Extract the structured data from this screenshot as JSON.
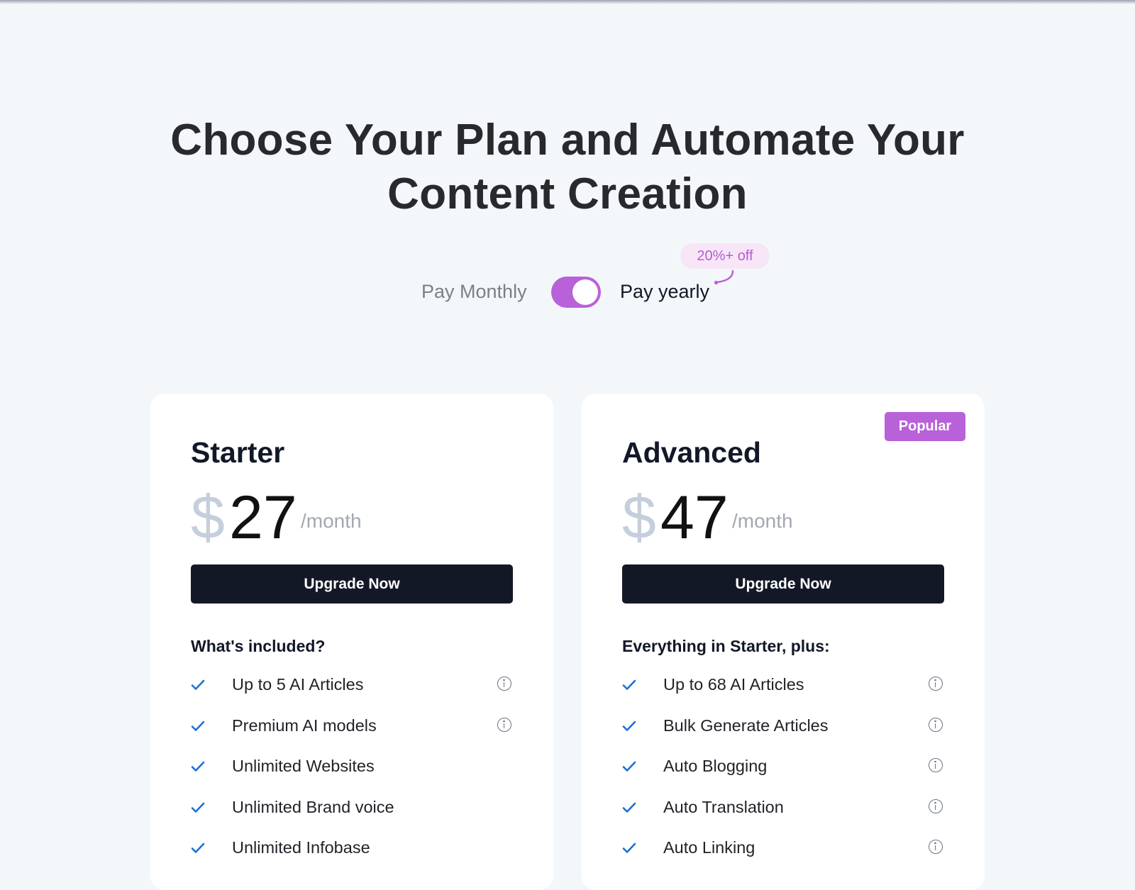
{
  "hero": {
    "title_line1": "Choose Your Plan and Automate Your",
    "title_line2": "Content Creation"
  },
  "billing": {
    "monthly_label": "Pay Monthly",
    "yearly_label": "Pay yearly",
    "discount_badge": "20%+ off",
    "yearly_selected": true,
    "accent_color": "#b861d8"
  },
  "plans": [
    {
      "name": "Starter",
      "currency": "$",
      "price": "27",
      "period": "/month",
      "cta": "Upgrade Now",
      "features_heading": "What's included?",
      "features": [
        {
          "label": "Up to 5 AI Articles",
          "info_icon": true
        },
        {
          "label": "Premium AI models",
          "info_icon": true
        },
        {
          "label": "Unlimited Websites",
          "info_icon": false
        },
        {
          "label": "Unlimited Brand voice",
          "info_icon": false
        },
        {
          "label": "Unlimited Infobase",
          "info_icon": false
        }
      ]
    },
    {
      "name": "Advanced",
      "badge": "Popular",
      "currency": "$",
      "price": "47",
      "period": "/month",
      "cta": "Upgrade Now",
      "features_heading": "Everything in Starter, plus:",
      "features": [
        {
          "label": "Up to 68 AI Articles",
          "info_icon": true
        },
        {
          "label": "Bulk Generate Articles",
          "info_icon": true
        },
        {
          "label": "Auto Blogging",
          "info_icon": true
        },
        {
          "label": "Auto Translation",
          "info_icon": true
        },
        {
          "label": "Auto Linking",
          "info_icon": true
        }
      ]
    }
  ],
  "icons": {
    "feature_bullet": "check-icon",
    "feature_info": "info-icon",
    "discount_pointer": "curved-arrow-icon"
  },
  "colors": {
    "background": "#f4f7fa",
    "accent": "#b861d8",
    "button": "#121826",
    "check": "#1d6fd8"
  }
}
